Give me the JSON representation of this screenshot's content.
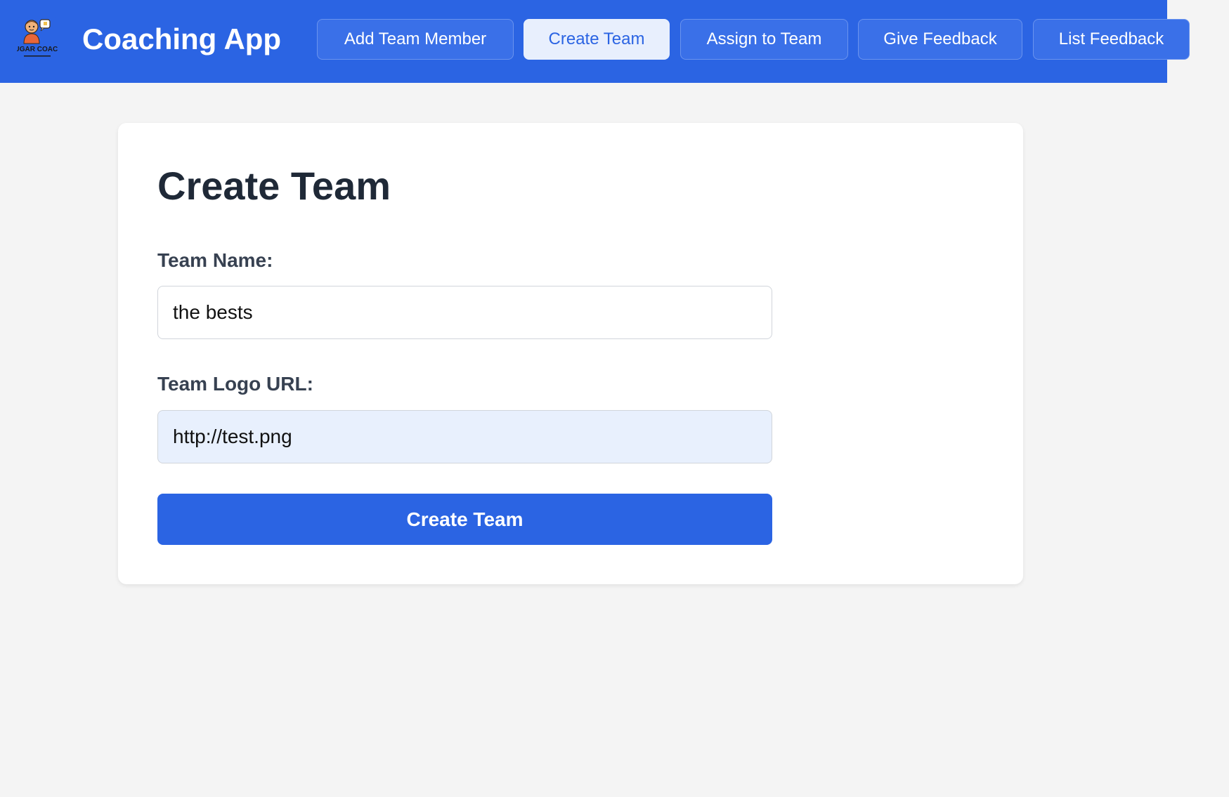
{
  "header": {
    "logo_icon": "nosugar-coaching-logo-icon",
    "logo_text": "NOSUGAR COACHING",
    "app_title": "Coaching App",
    "nav": [
      {
        "label": "Add Team Member",
        "active": false
      },
      {
        "label": "Create Team",
        "active": true
      },
      {
        "label": "Assign to Team",
        "active": false
      },
      {
        "label": "Give Feedback",
        "active": false
      },
      {
        "label": "List Feedback",
        "active": false
      }
    ]
  },
  "form": {
    "title": "Create Team",
    "team_name": {
      "label": "Team Name:",
      "value": "the bests"
    },
    "team_logo_url": {
      "label": "Team Logo URL:",
      "value": "http://test.png"
    },
    "submit_label": "Create Team"
  },
  "colors": {
    "brand": "#2b64e3",
    "page_bg": "#f4f4f4",
    "autofill_bg": "#e8f0fd"
  }
}
